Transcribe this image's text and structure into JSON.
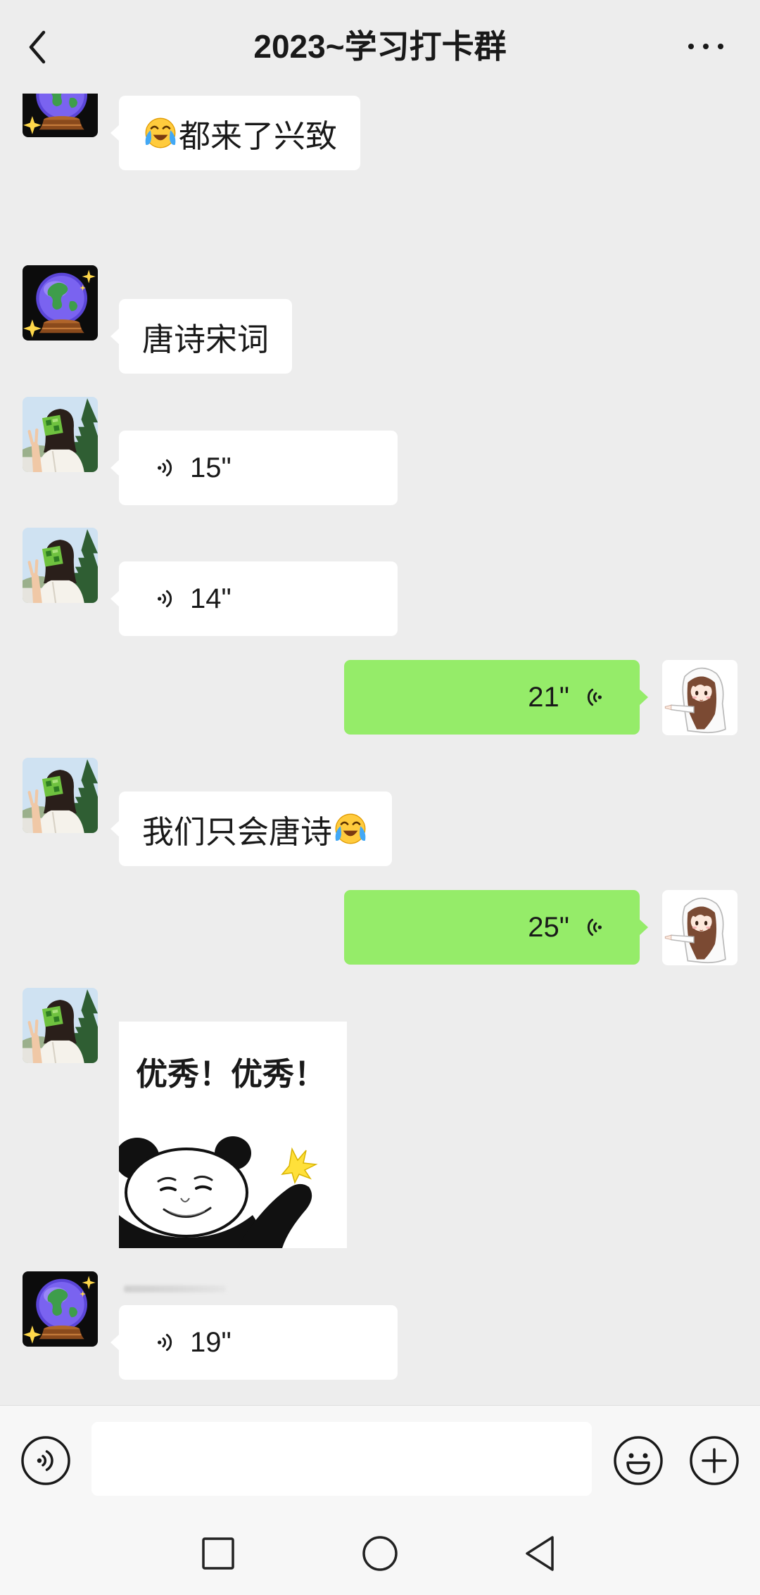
{
  "header": {
    "title": "2023~学习打卡群",
    "back_icon": "chevron-left-icon",
    "more_icon": "more-dots-icon"
  },
  "colors": {
    "background": "#ededed",
    "bubble_incoming": "#ffffff",
    "bubble_outgoing": "#95ec69",
    "text": "#191919",
    "input_bar": "#f7f7f7"
  },
  "messages": [
    {
      "outgoing": false,
      "avatar": "crystal-ball-avatar",
      "leading_emoji": "crying-laughing-emoji-icon",
      "text": "都来了兴致"
    },
    {
      "outgoing": false,
      "avatar": "crystal-ball-avatar",
      "text": "唐诗宋词"
    },
    {
      "outgoing": false,
      "avatar": "girl-landscape-avatar",
      "voice_icon": "voice-wave-icon",
      "duration": "15\""
    },
    {
      "outgoing": false,
      "avatar": "girl-landscape-avatar",
      "voice_icon": "voice-wave-icon",
      "duration": "14\""
    },
    {
      "outgoing": true,
      "avatar": "anime-girl-avatar",
      "voice_icon": "voice-wave-icon",
      "duration": "21\""
    },
    {
      "outgoing": false,
      "avatar": "girl-landscape-avatar",
      "text": "我们只会唐诗",
      "trailing_emoji": "crying-laughing-emoji-icon"
    },
    {
      "outgoing": true,
      "avatar": "anime-girl-avatar",
      "voice_icon": "voice-wave-icon",
      "duration": "25\""
    },
    {
      "outgoing": false,
      "avatar": "girl-landscape-avatar",
      "sticker": "panda-meme-sticker",
      "caption": "优秀！优秀！"
    },
    {
      "outgoing": false,
      "avatar": "crystal-ball-avatar",
      "voice_icon": "voice-wave-icon",
      "duration": "19\""
    }
  ],
  "input_bar": {
    "voice_icon": "voice-mode-icon",
    "input_value": "",
    "emoji_icon": "emoji-smiley-icon",
    "plus_icon": "plus-icon"
  },
  "nav_bar": {
    "recents_icon": "square-icon",
    "home_icon": "circle-icon",
    "back_icon": "triangle-back-icon"
  }
}
